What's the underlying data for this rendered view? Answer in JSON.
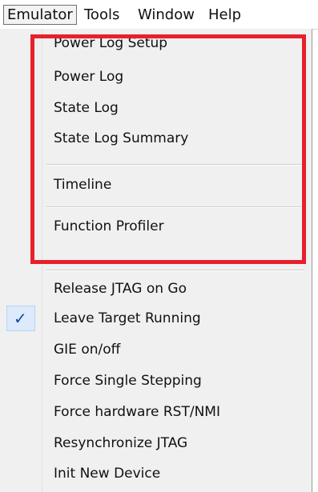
{
  "menubar": {
    "items": [
      "Emulator",
      "Tools",
      "Window",
      "Help"
    ]
  },
  "menu": {
    "items": [
      "Power Log Setup",
      "Power Log",
      "State Log",
      "State Log Summary",
      "Timeline",
      "Function Profiler",
      "Release JTAG on Go",
      "Leave Target Running",
      "GIE on/off",
      "Force Single Stepping",
      "Force hardware RST/NMI",
      "Resynchronize JTAG",
      "Init New Device"
    ],
    "checked_item": "Leave Target Running",
    "check_glyph": "✓"
  },
  "colors": {
    "highlight": "#e8202a",
    "check": "#1a43a8"
  }
}
